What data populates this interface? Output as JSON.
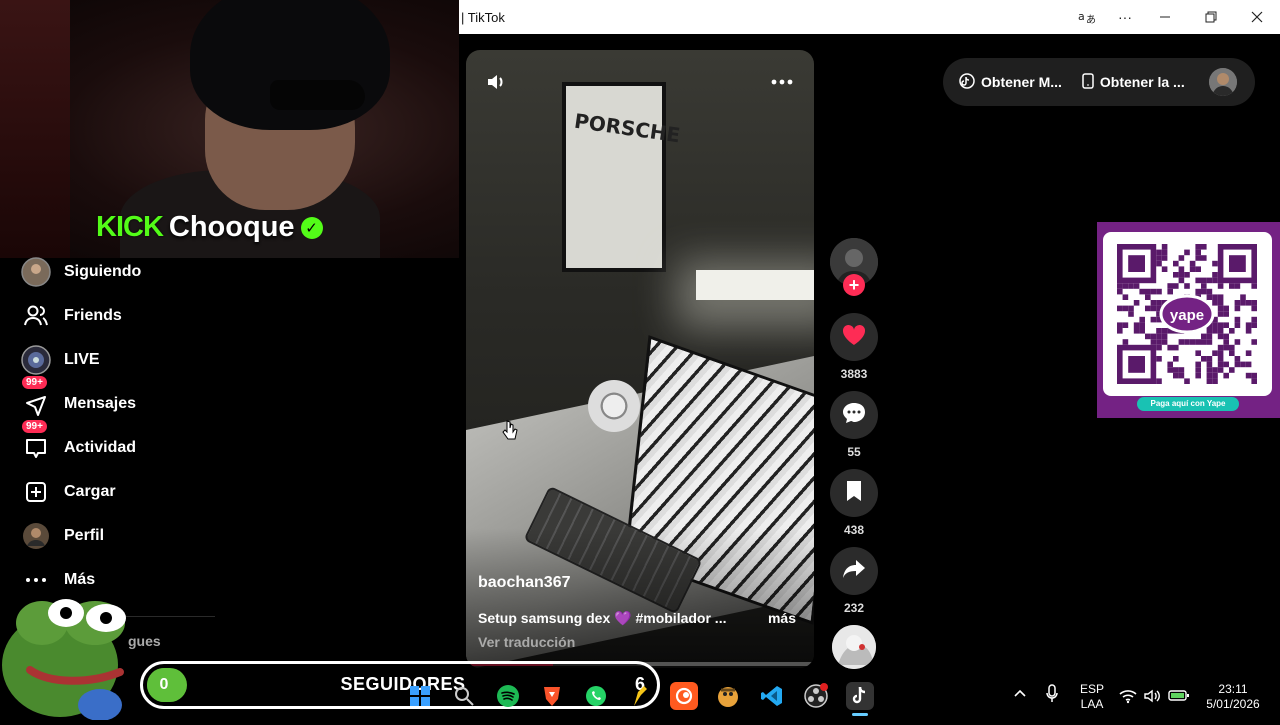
{
  "window": {
    "title": "| TikTok"
  },
  "stream_overlay": {
    "kick_logo": "KICK",
    "streamer_name": "Chooque",
    "followers_label": "SEGUIDORES",
    "followers_current": "0",
    "followers_goal": "6"
  },
  "sidebar": {
    "items": [
      {
        "label": "Siguiendo",
        "icon": "avatar-icon"
      },
      {
        "label": "Friends",
        "icon": "friends-icon"
      },
      {
        "label": "LIVE",
        "icon": "live-icon"
      },
      {
        "label": "Mensajes",
        "icon": "messages-icon",
        "badge": "99+"
      },
      {
        "label": "Actividad",
        "icon": "activity-icon",
        "badge": "99+"
      },
      {
        "label": "Cargar",
        "icon": "upload-icon"
      },
      {
        "label": "Perfil",
        "icon": "profile-icon"
      },
      {
        "label": "Más",
        "icon": "more-icon"
      }
    ],
    "partial_text": "gues"
  },
  "video": {
    "username": "baochan367",
    "description": "Setup samsung dex 💜 #mobilador ...",
    "more_label": "más",
    "translate_label": "Ver traducción",
    "poster_text": "PORSCHE",
    "progress": 0.25
  },
  "actions": {
    "likes": "3883",
    "comments": "55",
    "saves": "438",
    "shares": "232"
  },
  "top_right": {
    "link1": "Obtener M...",
    "link2": "Obtener la ..."
  },
  "qr": {
    "brand": "yape",
    "pay_label": "Paga aquí con Yape"
  },
  "taskbar": {
    "lang_top": "ESP",
    "lang_bottom": "LAA",
    "time": "23:11",
    "date": "5/01/2026"
  },
  "colors": {
    "accent": "#fe2c55",
    "kick_green": "#53fc18",
    "yape_purple": "#742284"
  }
}
